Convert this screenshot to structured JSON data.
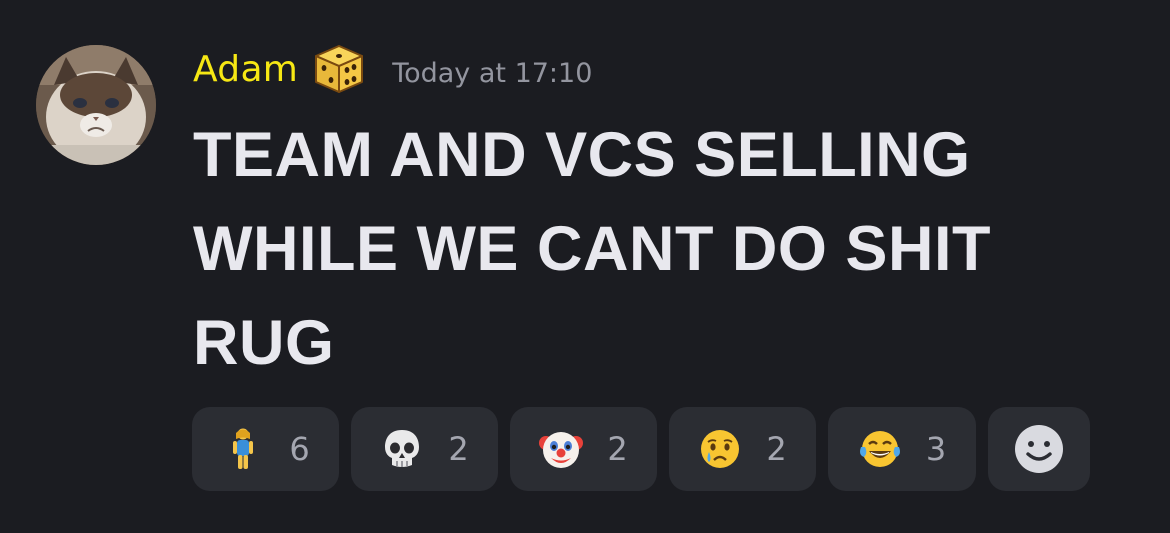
{
  "message": {
    "author": "Adam",
    "author_color": "#f6e714",
    "role_icon": "dice-icon",
    "timestamp": "Today at 17:10",
    "lines": [
      "TEAM AND VCS SELLING",
      "WHILE WE CANT DO SHIT",
      "RUG"
    ]
  },
  "reactions": [
    {
      "emoji": "woman-standing-icon",
      "count": "6"
    },
    {
      "emoji": "skull-icon",
      "count": "2"
    },
    {
      "emoji": "clown-face-icon",
      "count": "2"
    },
    {
      "emoji": "crying-face-icon",
      "count": "2"
    },
    {
      "emoji": "tears-of-joy-icon",
      "count": "3"
    }
  ],
  "add_reaction_icon": "add-reaction-smiley-icon"
}
